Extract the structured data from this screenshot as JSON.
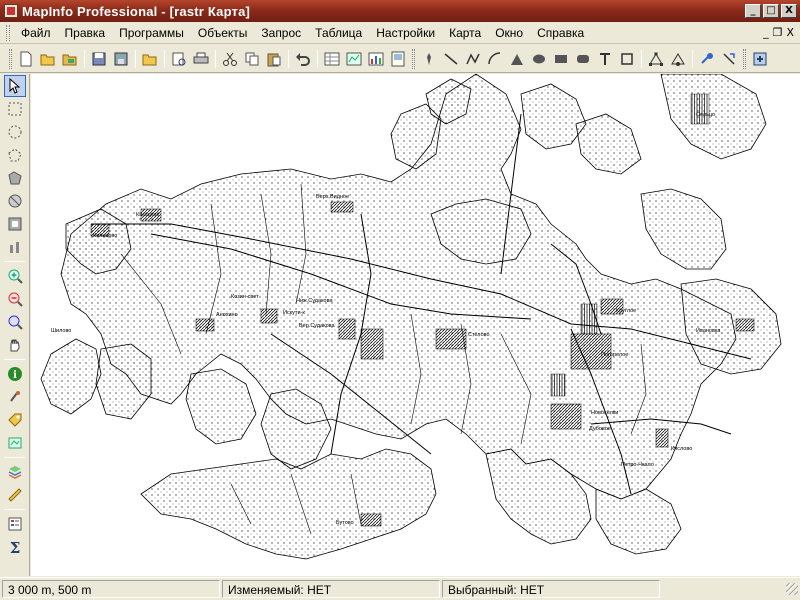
{
  "window": {
    "title": "MapInfo Professional - [rastr Карта]",
    "minimize_label": "_",
    "maximize_label": "□",
    "close_label": "X"
  },
  "menu": {
    "items": [
      {
        "label": "Файл"
      },
      {
        "label": "Правка"
      },
      {
        "label": "Программы"
      },
      {
        "label": "Объекты"
      },
      {
        "label": "Запрос"
      },
      {
        "label": "Таблица"
      },
      {
        "label": "Настройки"
      },
      {
        "label": "Карта"
      },
      {
        "label": "Окно"
      },
      {
        "label": "Справка"
      }
    ],
    "mdi_minimize": "_",
    "mdi_restore": "❐",
    "mdi_close": "X"
  },
  "map_labels": {
    "l1": "Казацкое",
    "l2": "Кольцово",
    "l3": "Верх.Видное",
    "l4": "Шилово",
    "l5": "Анохино",
    "l6": "Козин-свет",
    "l7": "Ниж.Судакова",
    "l8": "Искути-к",
    "l9": "Вер.Судакова",
    "l10": "Стелово",
    "l11": "Круглое",
    "l12": "Погорелое",
    "l13": "Дубовое",
    "l14": "Новоселки",
    "l15": "Кислово",
    "l16": "Петро-Чкало",
    "l17": "Ивановка",
    "l18": "Сельцо",
    "l19": "Бутово"
  },
  "status": {
    "scale": "3 000 m, 500 m",
    "editable": "Изменяемый: НЕТ",
    "selected": "Выбранный: НЕТ"
  }
}
